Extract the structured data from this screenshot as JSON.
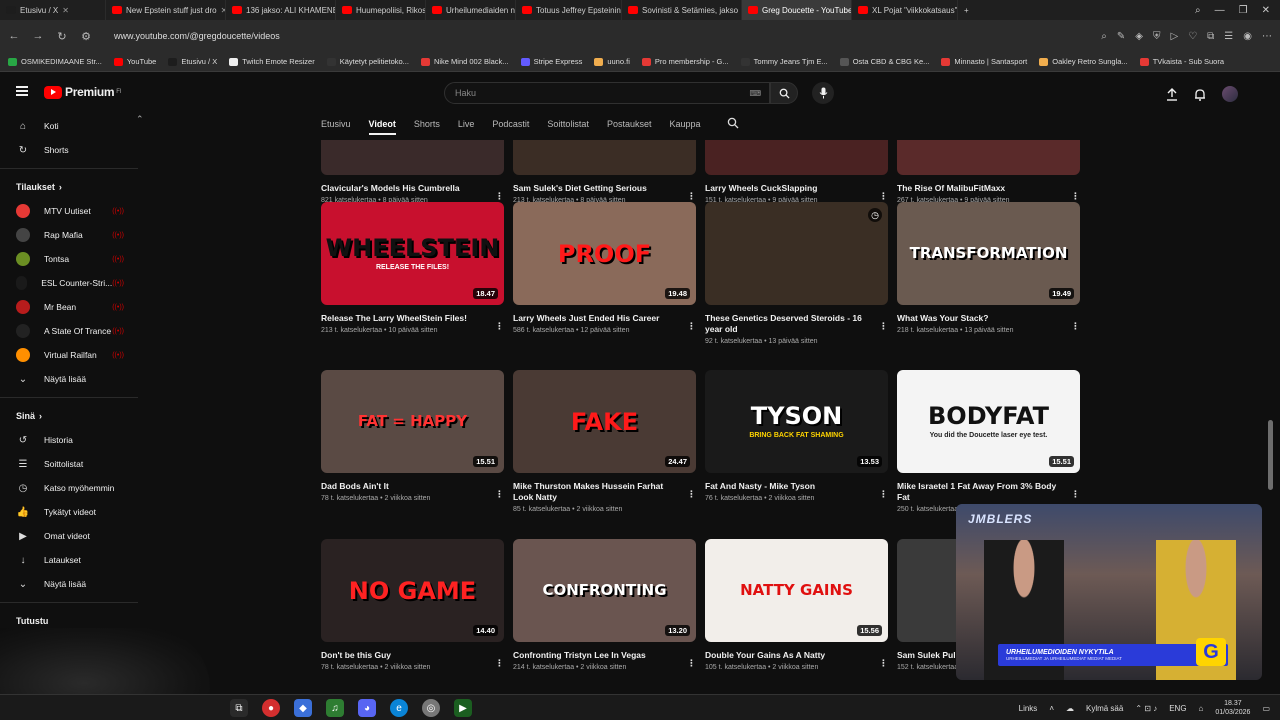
{
  "browser": {
    "tabs": [
      {
        "label": "Etusivu / X",
        "color": "#1d1d1d"
      },
      {
        "label": "New Epstein stuff just dro",
        "color": "#ff0000"
      },
      {
        "label": "136 jakso: ALI KHAMENEI",
        "color": "#ff0000"
      },
      {
        "label": "Huumepoliisi, Rikosmaail",
        "color": "#ff0000"
      },
      {
        "label": "Urheilumediaiden nyk",
        "color": "#ff0000"
      },
      {
        "label": "Totuus Jeffrey Epsteinin K",
        "color": "#ff0000"
      },
      {
        "label": "Sovinisti & Setämies, jakso",
        "color": "#ff0000"
      },
      {
        "label": "Greg Doucette - YouTube",
        "color": "#ff0000"
      },
      {
        "label": "XL Pojat \"viikkokatsaus\" 1",
        "color": "#ff0000"
      }
    ],
    "url": "www.youtube.com/@gregdoucette/videos",
    "bookmarks": [
      {
        "label": "OSMIKEDIMAANE Str...",
        "color": "#28a745"
      },
      {
        "label": "YouTube",
        "color": "#ff0000"
      },
      {
        "label": "Etusivu / X",
        "color": "#1d1d1d"
      },
      {
        "label": "Twitch Emote Resizer",
        "color": "#eeeeee"
      },
      {
        "label": "Käytetyt pelitietoko...",
        "color": "#333333"
      },
      {
        "label": "Nike Mind 002 Black...",
        "color": "#e53935"
      },
      {
        "label": "Stripe Express",
        "color": "#635bff"
      },
      {
        "label": "uuno.fi",
        "color": "#f0ad4e"
      },
      {
        "label": "Pro membership - G...",
        "color": "#e53935"
      },
      {
        "label": "Tommy Jeans Tjm E...",
        "color": "#333333"
      },
      {
        "label": "Osta CBD & CBG Ke...",
        "color": "#555555"
      },
      {
        "label": "Minnasto | Santasport",
        "color": "#e53935"
      },
      {
        "label": "Oakley Retro Sungla...",
        "color": "#f0ad4e"
      },
      {
        "label": "TVkaista - Sub Suora",
        "color": "#e53935"
      }
    ]
  },
  "masthead": {
    "logo_text": "Premium",
    "logo_sup": "FI",
    "search_placeholder": "Haku",
    "kbd": "⌨"
  },
  "sidebar": {
    "main": [
      {
        "label": "Koti",
        "icon": "⌂"
      },
      {
        "label": "Shorts",
        "icon": "↻"
      }
    ],
    "subs_header": "Tilaukset",
    "subscriptions": [
      {
        "label": "MTV Uutiset",
        "color": "#e53935"
      },
      {
        "label": "Rap Mafia",
        "color": "#444444"
      },
      {
        "label": "Tontsa",
        "color": "#6b8e23"
      },
      {
        "label": "ESL Counter-Stri...",
        "color": "#1a1a1a"
      },
      {
        "label": "Mr Bean",
        "color": "#b71c1c"
      },
      {
        "label": "A State Of Trance",
        "color": "#222222"
      },
      {
        "label": "Virtual Railfan",
        "color": "#ff8f00"
      },
      {
        "label": "Näytä lisää",
        "color": ""
      }
    ],
    "you_header": "Sinä",
    "you": [
      {
        "label": "Historia",
        "icon": "↺"
      },
      {
        "label": "Soittolistat",
        "icon": "☰"
      },
      {
        "label": "Katso myöhemmin",
        "icon": "◷"
      },
      {
        "label": "Tykätyt videot",
        "icon": "👍"
      },
      {
        "label": "Omat videot",
        "icon": "▶"
      },
      {
        "label": "Lataukset",
        "icon": "↓"
      },
      {
        "label": "Näytä lisää",
        "icon": "⌄"
      }
    ],
    "explore_header": "Tutustu"
  },
  "channel_tabs": [
    "Etusivu",
    "Videot",
    "Shorts",
    "Live",
    "Podcastit",
    "Soittolistat",
    "Postaukset",
    "Kauppa"
  ],
  "videos": [
    {
      "title": "Clavicular's Models His Cumbrella",
      "meta": "821 katselukertaa • 8 päivää sitten",
      "thumb_text": "",
      "bg": "#3a2a2a",
      "fg": "#ffffff",
      "duration": ""
    },
    {
      "title": "Sam Sulek's Diet Getting Serious",
      "meta": "213 t. katselukertaa • 8 päivää sitten",
      "thumb_text": "",
      "bg": "#3b2d25",
      "fg": "#ffffff",
      "duration": ""
    },
    {
      "title": "Larry Wheels CuckSlapping",
      "meta": "151 t. katselukertaa • 9 päivää sitten",
      "thumb_text": "",
      "bg": "#4a2222",
      "fg": "#ffffff",
      "duration": ""
    },
    {
      "title": "The Rise Of MalibuFitMaxx",
      "meta": "267 t. katselukertaa • 9 päivää sitten",
      "thumb_text": "",
      "bg": "#5a2a2a",
      "fg": "#ffffff",
      "duration": ""
    },
    {
      "title": "Release The Larry WheelStein Files!",
      "meta": "213 t. katselukertaa • 10 päivää sitten",
      "thumb_text": "WHEELSTEIN",
      "thumb_sub": "RELEASE THE FILES!",
      "bg": "#c8102e",
      "fg": "#111111",
      "duration": "18.47"
    },
    {
      "title": "Larry Wheels Just Ended His Career",
      "meta": "586 t. katselukertaa • 12 päivää sitten",
      "thumb_text": "PROOF",
      "thumb_sub": "",
      "bg": "#8a6a5a",
      "fg": "#ff1a1a",
      "duration": "19.48"
    },
    {
      "title": "These Genetics Deserved Steroids - 16 year old",
      "meta": "92 t. katselukertaa • 13 päivää sitten",
      "thumb_text": "",
      "thumb_sub": "",
      "bg": "#3a2e24",
      "fg": "#ffffff",
      "duration": ""
    },
    {
      "title": "What Was Your Stack?",
      "meta": "218 t. katselukertaa • 13 päivää sitten",
      "thumb_text": "TRANSFORMATION",
      "thumb_sub": "",
      "bg": "#6a5a50",
      "fg": "#ffffff",
      "duration": "19.49"
    },
    {
      "title": "Dad Bods Ain't It",
      "meta": "78 t. katselukertaa • 2 viikkoa sitten",
      "thumb_text": "FAT = HAPPY",
      "thumb_sub": "",
      "bg": "#5a4a44",
      "fg": "#ff3333",
      "duration": "15.51"
    },
    {
      "title": "Mike Thurston Makes Hussein Farhat Look Natty",
      "meta": "85 t. katselukertaa • 2 viikkoa sitten",
      "thumb_text": "FAKE",
      "thumb_sub": "",
      "bg": "#4a3a34",
      "fg": "#ff1a1a",
      "duration": "24.47"
    },
    {
      "title": "Fat And Nasty - Mike Tyson",
      "meta": "76 t. katselukertaa • 2 viikkoa sitten",
      "thumb_text": "TYSON",
      "thumb_sub": "BRING BACK FAT SHAMING",
      "bg": "#1a1a1a",
      "fg": "#ffffff",
      "duration": "13.53"
    },
    {
      "title": "Mike Israetel 1 Fat Away From 3% Body Fat",
      "meta": "250 t. katselukertaa • 2 viikkoa sitten",
      "thumb_text": "BODYFAT",
      "thumb_sub": "You did the Doucette laser eye test.",
      "bg": "#f4f4f4",
      "fg": "#111111",
      "duration": "15.51"
    },
    {
      "title": "Don't be this Guy",
      "meta": "78 t. katselukertaa • 2 viikkoa sitten",
      "thumb_text": "NO GAME",
      "thumb_sub": "",
      "bg": "#2a2222",
      "fg": "#ff2222",
      "duration": "14.40"
    },
    {
      "title": "Confronting Tristyn Lee In Vegas",
      "meta": "214 t. katselukertaa • 2 viikkoa sitten",
      "thumb_text": "CONFRONTING",
      "thumb_sub": "",
      "bg": "#6a5550",
      "fg": "#ffffff",
      "duration": "13.20"
    },
    {
      "title": "Double Your Gains As A Natty",
      "meta": "105 t. katselukertaa • 2 viikkoa sitten",
      "thumb_text": "NATTY GAINS",
      "thumb_sub": "",
      "bg": "#f2eeea",
      "fg": "#e01010",
      "duration": "15.56"
    },
    {
      "title": "Sam Sulek Pulli",
      "meta": "152 t. katselukertaa",
      "thumb_text": "S",
      "thumb_sub": "",
      "bg": "#3a3a3a",
      "fg": "#ff1a1a",
      "duration": ""
    }
  ],
  "webcam": {
    "sign": "JMBLERS",
    "banner_title": "URHEILUMEDIOIDEN NYKYTILA",
    "banner_sub": "URHEILUMEDIAT JA URHEILUMEDIAT MEDIAT MEDIAT",
    "badge": "G"
  },
  "taskbar": {
    "links": "Links",
    "weather": "Kylmä sää",
    "lang": "ENG",
    "time": "18.37",
    "date": "01/03/2026"
  }
}
